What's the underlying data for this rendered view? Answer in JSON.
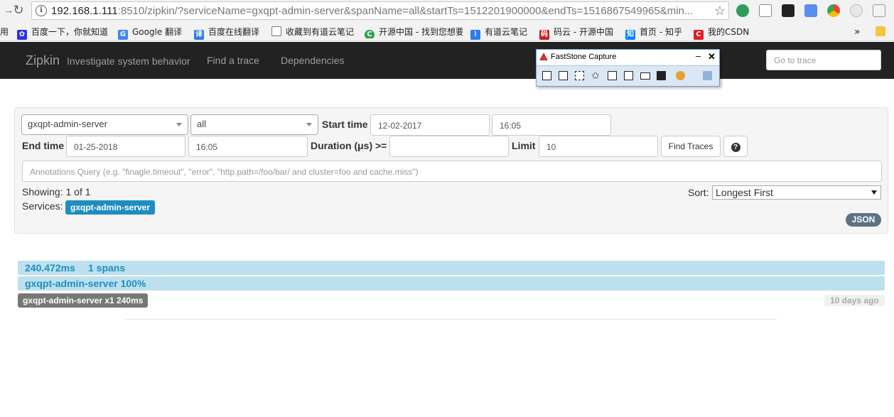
{
  "browser": {
    "url_host": "192.168.1.111",
    "url_rest": ":8510/zipkin/?serviceName=gxqpt-admin-server&spanName=all&startTs=1512201900000&endTs=1516867549965&min...",
    "bookmarks": [
      {
        "label": "用",
        "icon": "apps-icon",
        "color": "#4285f4"
      },
      {
        "label": "百度一下，你就知道",
        "icon": "baidu-paw-icon",
        "color": "#2932e1"
      },
      {
        "label": "Google 翻译",
        "icon": "google-translate-icon",
        "color": "#4285f4"
      },
      {
        "label": "百度在线翻译",
        "icon": "baidu-translate-icon",
        "color": "#2f7ee6"
      },
      {
        "label": "收藏到有道云笔记",
        "icon": "page-icon",
        "color": "#ffffff"
      },
      {
        "label": "开源中国 - 找到您想要",
        "icon": "oschina-icon",
        "color": "#2da44e"
      },
      {
        "label": "有道云笔记",
        "icon": "youdao-note-icon",
        "color": "#2b7de9"
      },
      {
        "label": "码云 - 开源中国",
        "icon": "gitee-icon",
        "color": "#c71d23"
      },
      {
        "label": "首页 - 知乎",
        "icon": "zhihu-icon",
        "color": "#0084ff"
      },
      {
        "label": "我的CSDN",
        "icon": "csdn-icon",
        "color": "#e51b24"
      }
    ],
    "more": "»"
  },
  "navbar": {
    "brand": "Zipkin",
    "tagline": "Investigate system behavior",
    "links": [
      "Find a trace",
      "Dependencies"
    ],
    "goto_placeholder": "Go to trace"
  },
  "faststone": {
    "title": "FastStone Capture",
    "minimize": "–",
    "close": "✕"
  },
  "search": {
    "service": "gxqpt-admin-server",
    "span": "all",
    "start_label": "Start time",
    "start_date": "12-02-2017",
    "start_time": "16:05",
    "end_label": "End time",
    "end_date": "01-25-2018",
    "end_time": "16:05",
    "duration_label": "Duration (μs) >=",
    "duration_value": "",
    "limit_label": "Limit",
    "limit_value": "10",
    "find_button": "Find Traces",
    "help_icon": "?",
    "annotations_placeholder": "Annotations Query (e.g. \"finagle.timeout\", \"error\", \"http.path=/foo/bar/ and cluster=foo and cache.miss\")",
    "showing": "Showing: 1 of 1",
    "services_label": "Services:",
    "services_badge": "gxqpt-admin-server",
    "sort_label": "Sort:",
    "sort_value": "Longest First",
    "json_button": "JSON"
  },
  "trace": {
    "duration": "240.472ms",
    "spans": "1 spans",
    "service_percent": "gxqpt-admin-server 100%",
    "service_tag": "gxqpt-admin-server x1 240ms",
    "age": "10 days ago"
  }
}
